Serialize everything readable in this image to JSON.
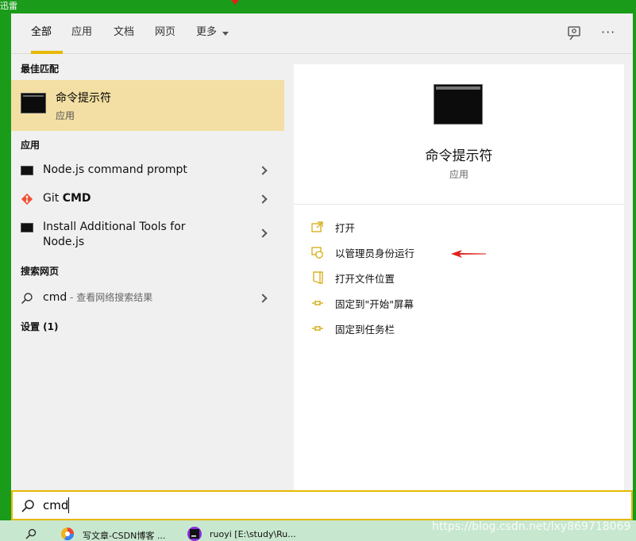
{
  "desktop": {
    "label": "迅雷"
  },
  "tabs": [
    {
      "label": "全部",
      "active": true
    },
    {
      "label": "应用"
    },
    {
      "label": "文档"
    },
    {
      "label": "网页"
    },
    {
      "label": "更多"
    }
  ],
  "toolbar": {
    "more_label": "···"
  },
  "best_match": {
    "section_title": "最佳匹配",
    "title": "命令提示符",
    "subtitle": "应用"
  },
  "apps": {
    "section_title": "应用",
    "items": [
      {
        "label": "Node.js command prompt"
      },
      {
        "label_prefix": "Git ",
        "label_bold": "CMD"
      },
      {
        "label_line1": "Install Additional Tools for",
        "label_line2": "Node.js"
      }
    ]
  },
  "web": {
    "section_title": "搜索网页",
    "query": "cmd",
    "hint": " - 查看网络搜索结果"
  },
  "settings": {
    "section_title": "设置 (1)"
  },
  "detail": {
    "title": "命令提示符",
    "subtitle": "应用",
    "actions": [
      {
        "label": "打开",
        "icon": "open-icon"
      },
      {
        "label": "以管理员身份运行",
        "icon": "shield-icon"
      },
      {
        "label": "打开文件位置",
        "icon": "file-location-icon"
      },
      {
        "label": "固定到\"开始\"屏幕",
        "icon": "pin-icon"
      },
      {
        "label": "固定到任务栏",
        "icon": "pin-icon"
      }
    ]
  },
  "search": {
    "value": "cmd"
  },
  "taskbar": {
    "items": [
      {
        "label": "写文章-CSDN博客 ..."
      },
      {
        "label": "ruoyi [E:\\study\\Ru..."
      }
    ],
    "watermark": "https://blog.csdn.net/lxy869718069"
  },
  "colors": {
    "accent": "#e6b800",
    "selected": "#f3dfa3",
    "desktop": "#1a9b1a",
    "arrow": "#e0221b"
  }
}
